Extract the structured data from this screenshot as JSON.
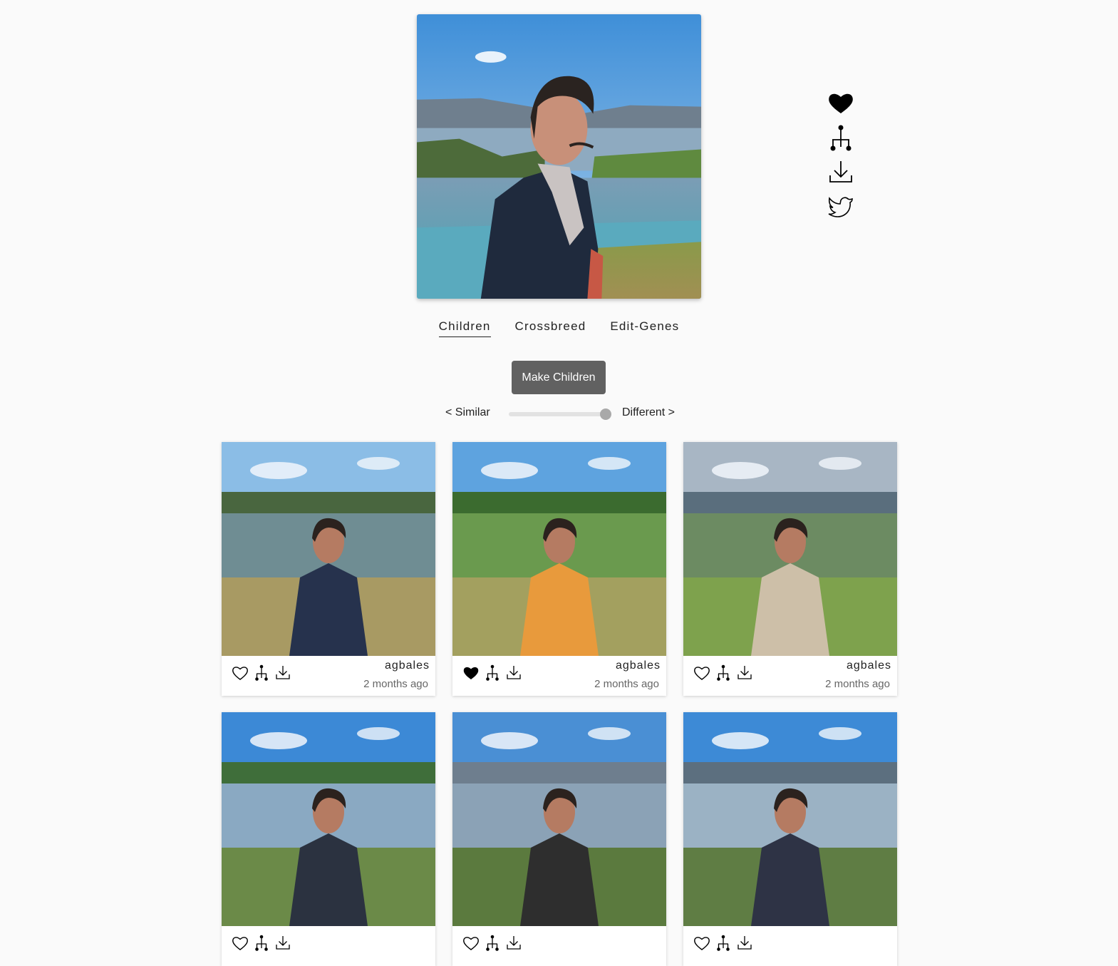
{
  "hero": {
    "image_alt": "Generated portrait: child in dark shirt standing by a lake"
  },
  "side_actions": [
    {
      "name": "favorite-icon"
    },
    {
      "name": "lineage-tree-icon"
    },
    {
      "name": "download-icon"
    },
    {
      "name": "twitter-icon"
    }
  ],
  "tabs": [
    {
      "label": "Children",
      "active": true
    },
    {
      "label": "Crossbreed",
      "active": false
    },
    {
      "label": "Edit-Genes",
      "active": false
    }
  ],
  "make_button": "Make Children",
  "slider": {
    "left_label": "< Similar",
    "right_label": "Different >",
    "value": 1.0
  },
  "cards": [
    {
      "author": "agbales",
      "time": "2 months ago",
      "liked": false
    },
    {
      "author": "agbales",
      "time": "2 months ago",
      "liked": true
    },
    {
      "author": "agbales",
      "time": "2 months ago",
      "liked": false
    },
    {
      "author": "",
      "time": "",
      "liked": false
    },
    {
      "author": "",
      "time": "",
      "liked": false
    },
    {
      "author": "",
      "time": "",
      "liked": false
    }
  ],
  "colors": {
    "button_bg": "#616161",
    "background": "#fafafa"
  }
}
